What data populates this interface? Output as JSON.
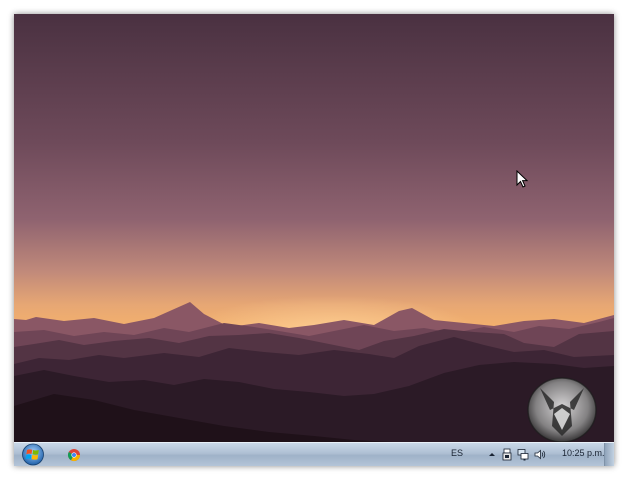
{
  "desktop": {
    "wallpaper": "sunset-mountains",
    "sky_top_color": "#4a3141",
    "sky_mid_color": "#8b5d6c",
    "horizon_color": "#f5b770",
    "mountain_color": "#2b1a26"
  },
  "taskbar": {
    "start_icon": "windows-start-orb-icon",
    "pinned_apps": [
      "chrome-icon"
    ],
    "language": "ES",
    "tray_icons": [
      "show-hidden-icons",
      "usb-device-icon",
      "network-icon",
      "volume-icon"
    ],
    "clock": "10:25 p.m."
  }
}
